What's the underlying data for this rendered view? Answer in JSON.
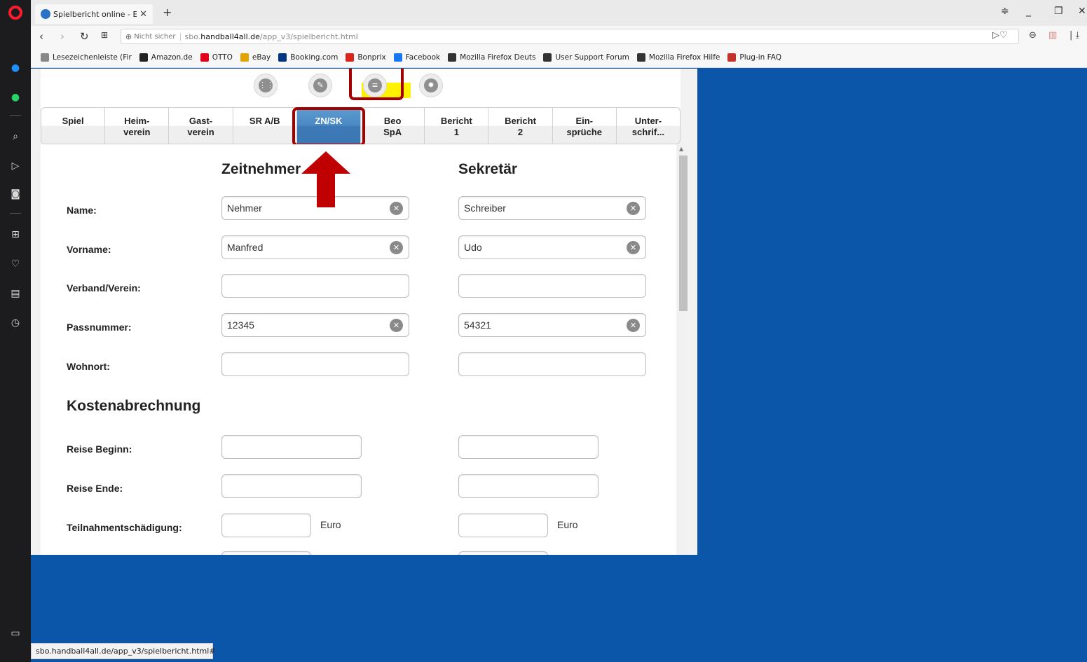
{
  "browser": {
    "tab_title": "Spielbericht online - Erfass",
    "tab_close": "✕",
    "new_tab": "+",
    "url_not_secure": "Nicht sicher",
    "url_host_prefix": "sbo.",
    "url_host": "handball4all.de",
    "url_path": "/app_v3/spielbericht.html",
    "status_url": "sbo.handball4all.de/app_v3/spielbericht.html#",
    "bookmarks": [
      {
        "label": "Lesezeichenleiste (Fir",
        "icon": "folder-icon",
        "color": "#888888"
      },
      {
        "label": "Amazon.de",
        "icon": "amazon-icon",
        "color": "#222222"
      },
      {
        "label": "OTTO",
        "icon": "otto-icon",
        "color": "#e3001b"
      },
      {
        "label": "eBay",
        "icon": "ebay-icon",
        "color": "#e2a400"
      },
      {
        "label": "Booking.com",
        "icon": "booking-icon",
        "color": "#003580"
      },
      {
        "label": "Bonprix",
        "icon": "bonprix-icon",
        "color": "#d9261c"
      },
      {
        "label": "Facebook",
        "icon": "facebook-icon",
        "color": "#1877f2"
      },
      {
        "label": "Mozilla Firefox Deuts",
        "icon": "page-icon",
        "color": "#333333"
      },
      {
        "label": "User Support Forum",
        "icon": "page-icon",
        "color": "#333333"
      },
      {
        "label": "Mozilla Firefox Hilfe",
        "icon": "page-icon",
        "color": "#333333"
      },
      {
        "label": "Plug-in FAQ",
        "icon": "plugin-icon",
        "color": "#c4302b"
      }
    ]
  },
  "app": {
    "top_icons": [
      "grid-icon",
      "pencil-icon",
      "menu-icon",
      "settings-icon"
    ],
    "highlight_color": "#a40000",
    "active_marker_color": "#fff200",
    "tabs": [
      {
        "line1": "Spiel",
        "line2": ""
      },
      {
        "line1": "Heim-",
        "line2": "verein"
      },
      {
        "line1": "Gast-",
        "line2": "verein"
      },
      {
        "line1": "SR A/B",
        "line2": ""
      },
      {
        "line1": "ZN/SK",
        "line2": "",
        "active": true
      },
      {
        "line1": "Beo",
        "line2": "SpA"
      },
      {
        "line1": "Bericht",
        "line2": "1"
      },
      {
        "line1": "Bericht",
        "line2": "2"
      },
      {
        "line1": "Ein-",
        "line2": "sprüche"
      },
      {
        "line1": "Unter-",
        "line2": "schrif..."
      }
    ],
    "columns": {
      "zeitnehmer": "Zeitnehmer",
      "sekretaer": "Sekretär"
    },
    "labels": {
      "name": "Name:",
      "vorname": "Vorname:",
      "verband": "Verband/Verein:",
      "passnummer": "Passnummer:",
      "wohnort": "Wohnort:",
      "kosten": "Kostenabrechnung",
      "reise_beginn": "Reise Beginn:",
      "reise_ende": "Reise Ende:",
      "teilnahme": "Teilnahmentschädigung:",
      "euro": "Euro"
    },
    "zeitnehmer": {
      "name": "Nehmer",
      "vorname": "Manfred",
      "verband": "",
      "passnummer": "12345",
      "wohnort": ""
    },
    "sekretaer": {
      "name": "Schreiber",
      "vorname": "Udo",
      "verband": "",
      "passnummer": "54321",
      "wohnort": ""
    }
  }
}
